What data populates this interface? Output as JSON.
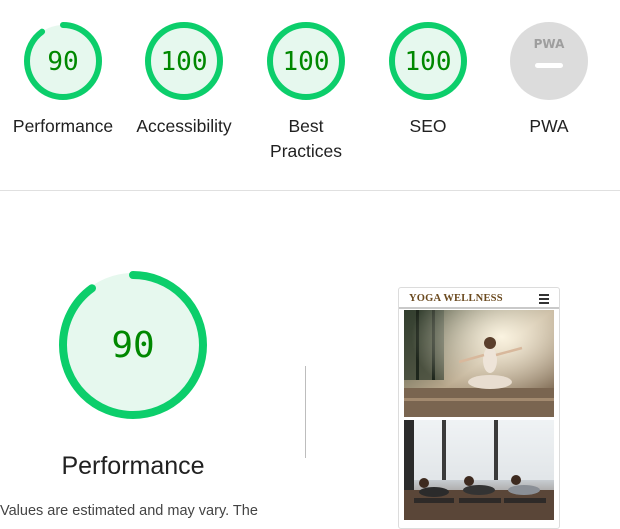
{
  "categories": [
    {
      "label": "Performance",
      "score": "90",
      "value": 90,
      "color": "#0cce6b"
    },
    {
      "label": "Accessibility",
      "score": "100",
      "value": 100,
      "color": "#0cce6b"
    },
    {
      "label": "Best Practices",
      "score": "100",
      "value": 100,
      "color": "#0cce6b"
    },
    {
      "label": "SEO",
      "score": "100",
      "value": 100,
      "color": "#0cce6b"
    },
    {
      "label": "PWA",
      "badge": "PWA",
      "color": "#dcdcdc"
    }
  ],
  "performance": {
    "score": "90",
    "value": 90,
    "title": "Performance",
    "disclaimer": "Values are estimated and may vary. The"
  },
  "screenshot": {
    "brand": "YOGA WELLNESS"
  },
  "colors": {
    "pass_ring": "#0cce6b",
    "pass_fill": "#e6f8ee",
    "pass_text": "#008800",
    "na_fill": "#dcdcdc"
  }
}
